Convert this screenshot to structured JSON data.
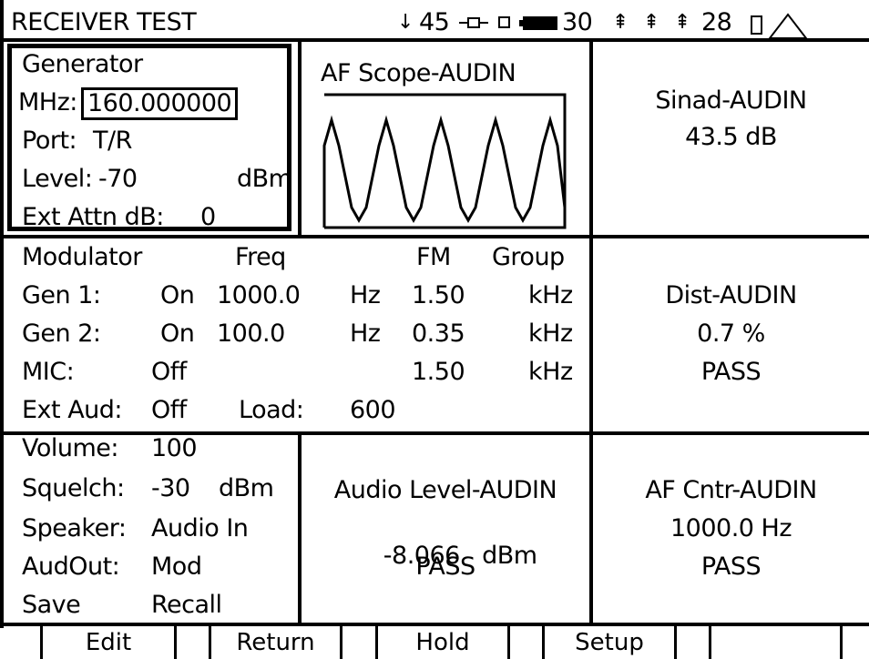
{
  "header": {
    "title": "RECEIVER TEST",
    "indicator_1": "45",
    "indicator_2": "30",
    "indicator_3": "28",
    "icons": [
      "down-arrow-icon",
      "plug-icon",
      "square-icon",
      "battery-icon",
      "antenna-1-icon",
      "antenna-2-icon",
      "antenna-3-icon",
      "box-icon",
      "warning-triangle-icon"
    ]
  },
  "generator": {
    "title": "Generator",
    "mhz_label": "MHz:",
    "mhz_value": "160.000000",
    "port_label": "Port:",
    "port_value": "T/R",
    "level_label": "Level:",
    "level_value": "-70",
    "level_unit": "dBm",
    "ext_attn_label": "Ext Attn dB:",
    "ext_attn_value": "0"
  },
  "scope": {
    "title": "AF Scope-AUDIN"
  },
  "sinad": {
    "title": "Sinad-AUDIN",
    "value": "43.5 dB"
  },
  "modulator": {
    "title": "Modulator",
    "col_freq": "Freq",
    "col_fm": "FM",
    "col_group": "Group",
    "rows": [
      {
        "label": "Gen 1:",
        "state": "On",
        "freq": "1000.0",
        "freq_unit": "Hz",
        "dev": "1.50",
        "dev_unit": "kHz"
      },
      {
        "label": "Gen 2:",
        "state": "On",
        "freq": "100.0",
        "freq_unit": "Hz",
        "dev": "0.35",
        "dev_unit": "kHz"
      },
      {
        "label": "MIC:",
        "state": "Off",
        "freq": "",
        "freq_unit": "",
        "dev": "1.50",
        "dev_unit": "kHz"
      }
    ],
    "ext_aud_label": "Ext Aud:",
    "ext_aud_value": "Off",
    "load_label": "Load:",
    "load_value": "600"
  },
  "dist": {
    "title": "Dist-AUDIN",
    "value": "0.7 %",
    "status": "PASS"
  },
  "audio_settings": {
    "volume_label": "Volume:",
    "volume_value": "100",
    "squelch_label": "Squelch:",
    "squelch_value": "-30",
    "squelch_unit": "dBm",
    "speaker_label": "Speaker:",
    "speaker_value": "Audio In",
    "audout_label": "AudOut:",
    "audout_value": "Mod",
    "save_label": "Save",
    "recall_label": "Recall"
  },
  "audio_level": {
    "title": "Audio Level-AUDIN",
    "value": "-8.066",
    "unit": "dBm",
    "status": "PASS"
  },
  "af_counter": {
    "title": "AF Cntr-AUDIN",
    "value": "1000.0 Hz",
    "status": "PASS"
  },
  "softkeys": [
    "Edit",
    "Return",
    "Hold",
    "Setup",
    ""
  ]
}
